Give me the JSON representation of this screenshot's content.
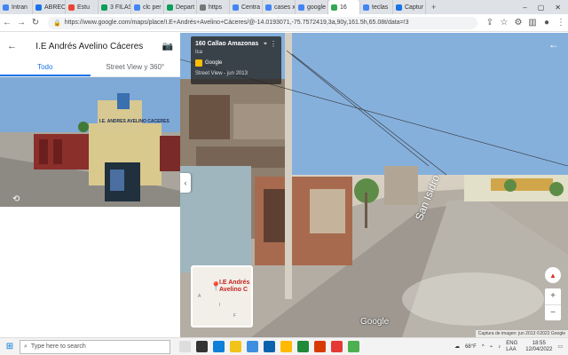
{
  "browser": {
    "tabs": [
      {
        "label": "Intran",
        "color": "#4285f4"
      },
      {
        "label": "ABREO",
        "color": "#1a73e8"
      },
      {
        "label": "Estu",
        "color": "#ea4335"
      },
      {
        "label": "3 FILAS",
        "color": "#0f9d58"
      },
      {
        "label": "clc per",
        "color": "#4285f4"
      },
      {
        "label": "Depart",
        "color": "#0f9d58"
      },
      {
        "label": "https",
        "color": "#777777"
      },
      {
        "label": "Centra",
        "color": "#4285f4"
      },
      {
        "label": "cases x",
        "color": "#4285f4"
      },
      {
        "label": "google",
        "color": "#4285f4"
      },
      {
        "label": "16",
        "color": "#34a853"
      },
      {
        "label": "teclas",
        "color": "#4285f4"
      },
      {
        "label": "Captur",
        "color": "#1a73e8"
      }
    ],
    "new_tab": "+",
    "url": "https://www.google.com/maps/place/I.E+Andrés+Avelino+Cáceres/@-14.0193071,-75.7572419,3a,90y,161.5h,65.08t/data=!3"
  },
  "sidepanel": {
    "title": "I.E Andrés Avelino Cáceres",
    "tabs": [
      {
        "label": "Todo",
        "active": true
      },
      {
        "label": "Street View y 360°",
        "active": false
      }
    ],
    "school_sign": "I.E. ANDRES AVELINO CACERES"
  },
  "streetview": {
    "place_title": "160 Callao Amazonas",
    "place_sub": "Ica",
    "source": "Google",
    "date": "Street View - jun 2013",
    "street_label": "San Isidro",
    "google_logo": "Google",
    "attribution": "Captura de imagen: jun 2013   ©2022 Google",
    "minimap_label": "I.E Andrés Avelino C"
  },
  "taskbar": {
    "search_placeholder": "Type here to search",
    "weather": "68°F",
    "lang": "ENG LAA",
    "time": "18:55",
    "date": "12/04/2022"
  }
}
